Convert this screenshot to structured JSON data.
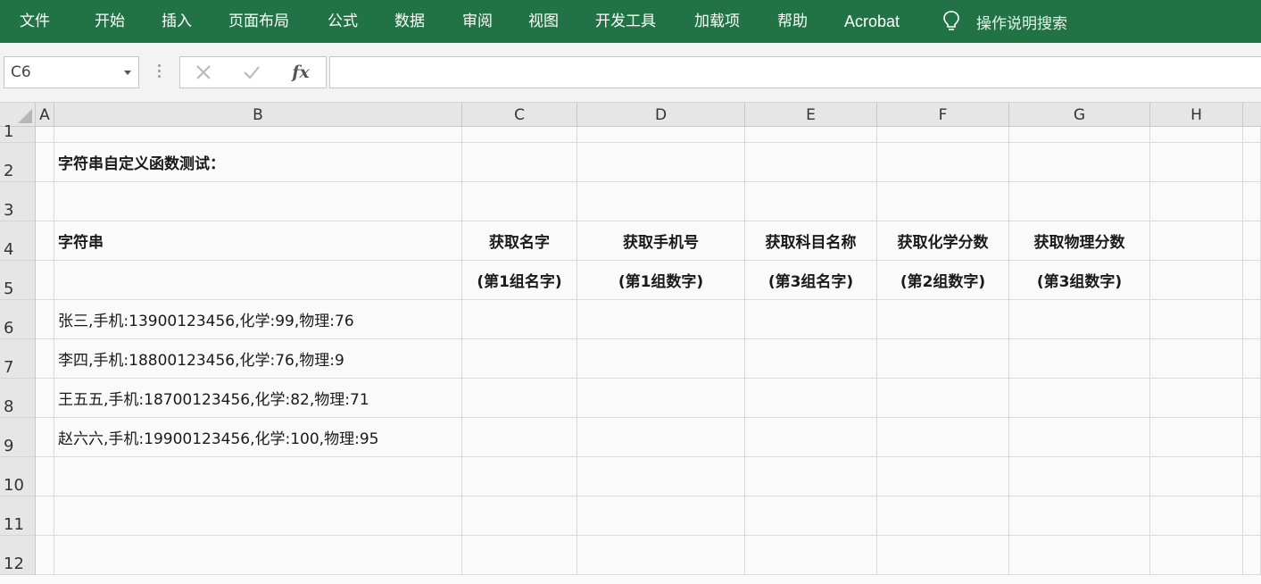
{
  "ribbon": {
    "tabs": [
      "文件",
      "开始",
      "插入",
      "页面布局",
      "公式",
      "数据",
      "审阅",
      "视图",
      "开发工具",
      "加载项",
      "帮助",
      "Acrobat"
    ],
    "tell_me": "操作说明搜索",
    "tell_me_icon": "lightbulb-icon",
    "background": "#217346"
  },
  "formula_bar": {
    "name_box": "C6",
    "fx_label": "fx",
    "formula": ""
  },
  "sheet": {
    "columns": [
      "A",
      "B",
      "C",
      "D",
      "E",
      "F",
      "G",
      "H"
    ],
    "rows": [
      "1",
      "2",
      "3",
      "4",
      "5",
      "6",
      "7",
      "8",
      "9",
      "10",
      "11",
      "12"
    ],
    "title": "字符串自定义函数测试：",
    "header_string": "字符串",
    "headers_row4": [
      "获取名字",
      "获取手机号",
      "获取科目名称",
      "获取化学分数",
      "获取物理分数"
    ],
    "headers_row5": [
      "(第1组名字)",
      "(第1组数字)",
      "(第3组名字)",
      "(第2组数字)",
      "(第3组数字)"
    ],
    "data_strings": [
      "张三,手机:13900123456,化学:99,物理:76",
      "李四,手机:18800123456,化学:76,物理:9",
      "王五五,手机:18700123456,化学:82,物理:71",
      "赵六六,手机:19900123456,化学:100,物理:95"
    ]
  }
}
